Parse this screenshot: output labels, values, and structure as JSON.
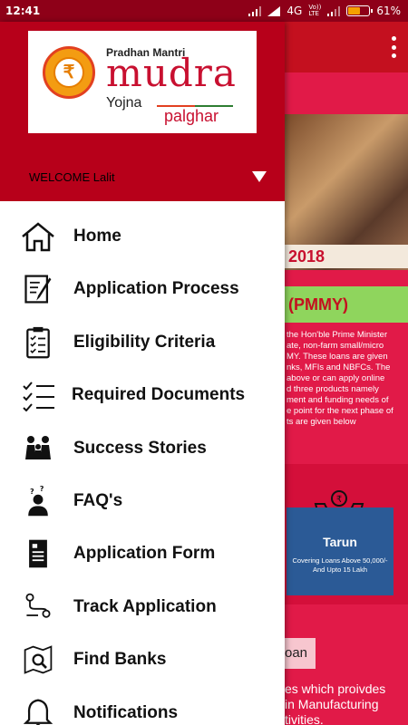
{
  "status_bar": {
    "time": "12:41",
    "network": "4G",
    "volte_top": "Vo))",
    "volte_bottom": "LTE",
    "battery_percent": "61%",
    "battery_level": 0.61
  },
  "background": {
    "banner_year": "2018",
    "pmmy_heading": "(PMMY)",
    "about_lines": [
      "the Hon'ble Prime Minister",
      "ate, non-farm small/micro",
      "MY. These loans are given",
      "nks, MFIs and NBFCs. The",
      "above or can apply online",
      "d three products namely",
      "ment and funding needs of",
      "e point for the next phase of",
      "ts are given below"
    ],
    "tarun_title": "Tarun",
    "tarun_desc_line1": "Covering Loans  Above  50,000/-",
    "tarun_desc_line2": "And Upto 15 Lakh",
    "loan_chip": "oan",
    "bottom_lines": [
      "es which proivdes",
      "in Manufacturing",
      "tivities."
    ]
  },
  "drawer": {
    "logo": {
      "top_text": "Pradhan Mantri",
      "brand": "mudra",
      "yojna": "Yojna",
      "location": "palghar",
      "rupee": "₹"
    },
    "welcome": "WELCOME Lalit",
    "menu": [
      {
        "label": "Home",
        "icon": "home-icon"
      },
      {
        "label": "Application Process",
        "icon": "edit-document-icon"
      },
      {
        "label": "Eligibility Criteria",
        "icon": "clipboard-checklist-icon"
      },
      {
        "label": "Required Documents",
        "icon": "checklist-icon"
      },
      {
        "label": "Success Stories",
        "icon": "people-icon"
      },
      {
        "label": "FAQ's",
        "icon": "question-person-icon"
      },
      {
        "label": "Application Form",
        "icon": "form-icon"
      },
      {
        "label": "Track Application",
        "icon": "route-icon"
      },
      {
        "label": "Find Banks",
        "icon": "map-search-icon"
      },
      {
        "label": "Notifications",
        "icon": "bell-icon"
      }
    ]
  }
}
